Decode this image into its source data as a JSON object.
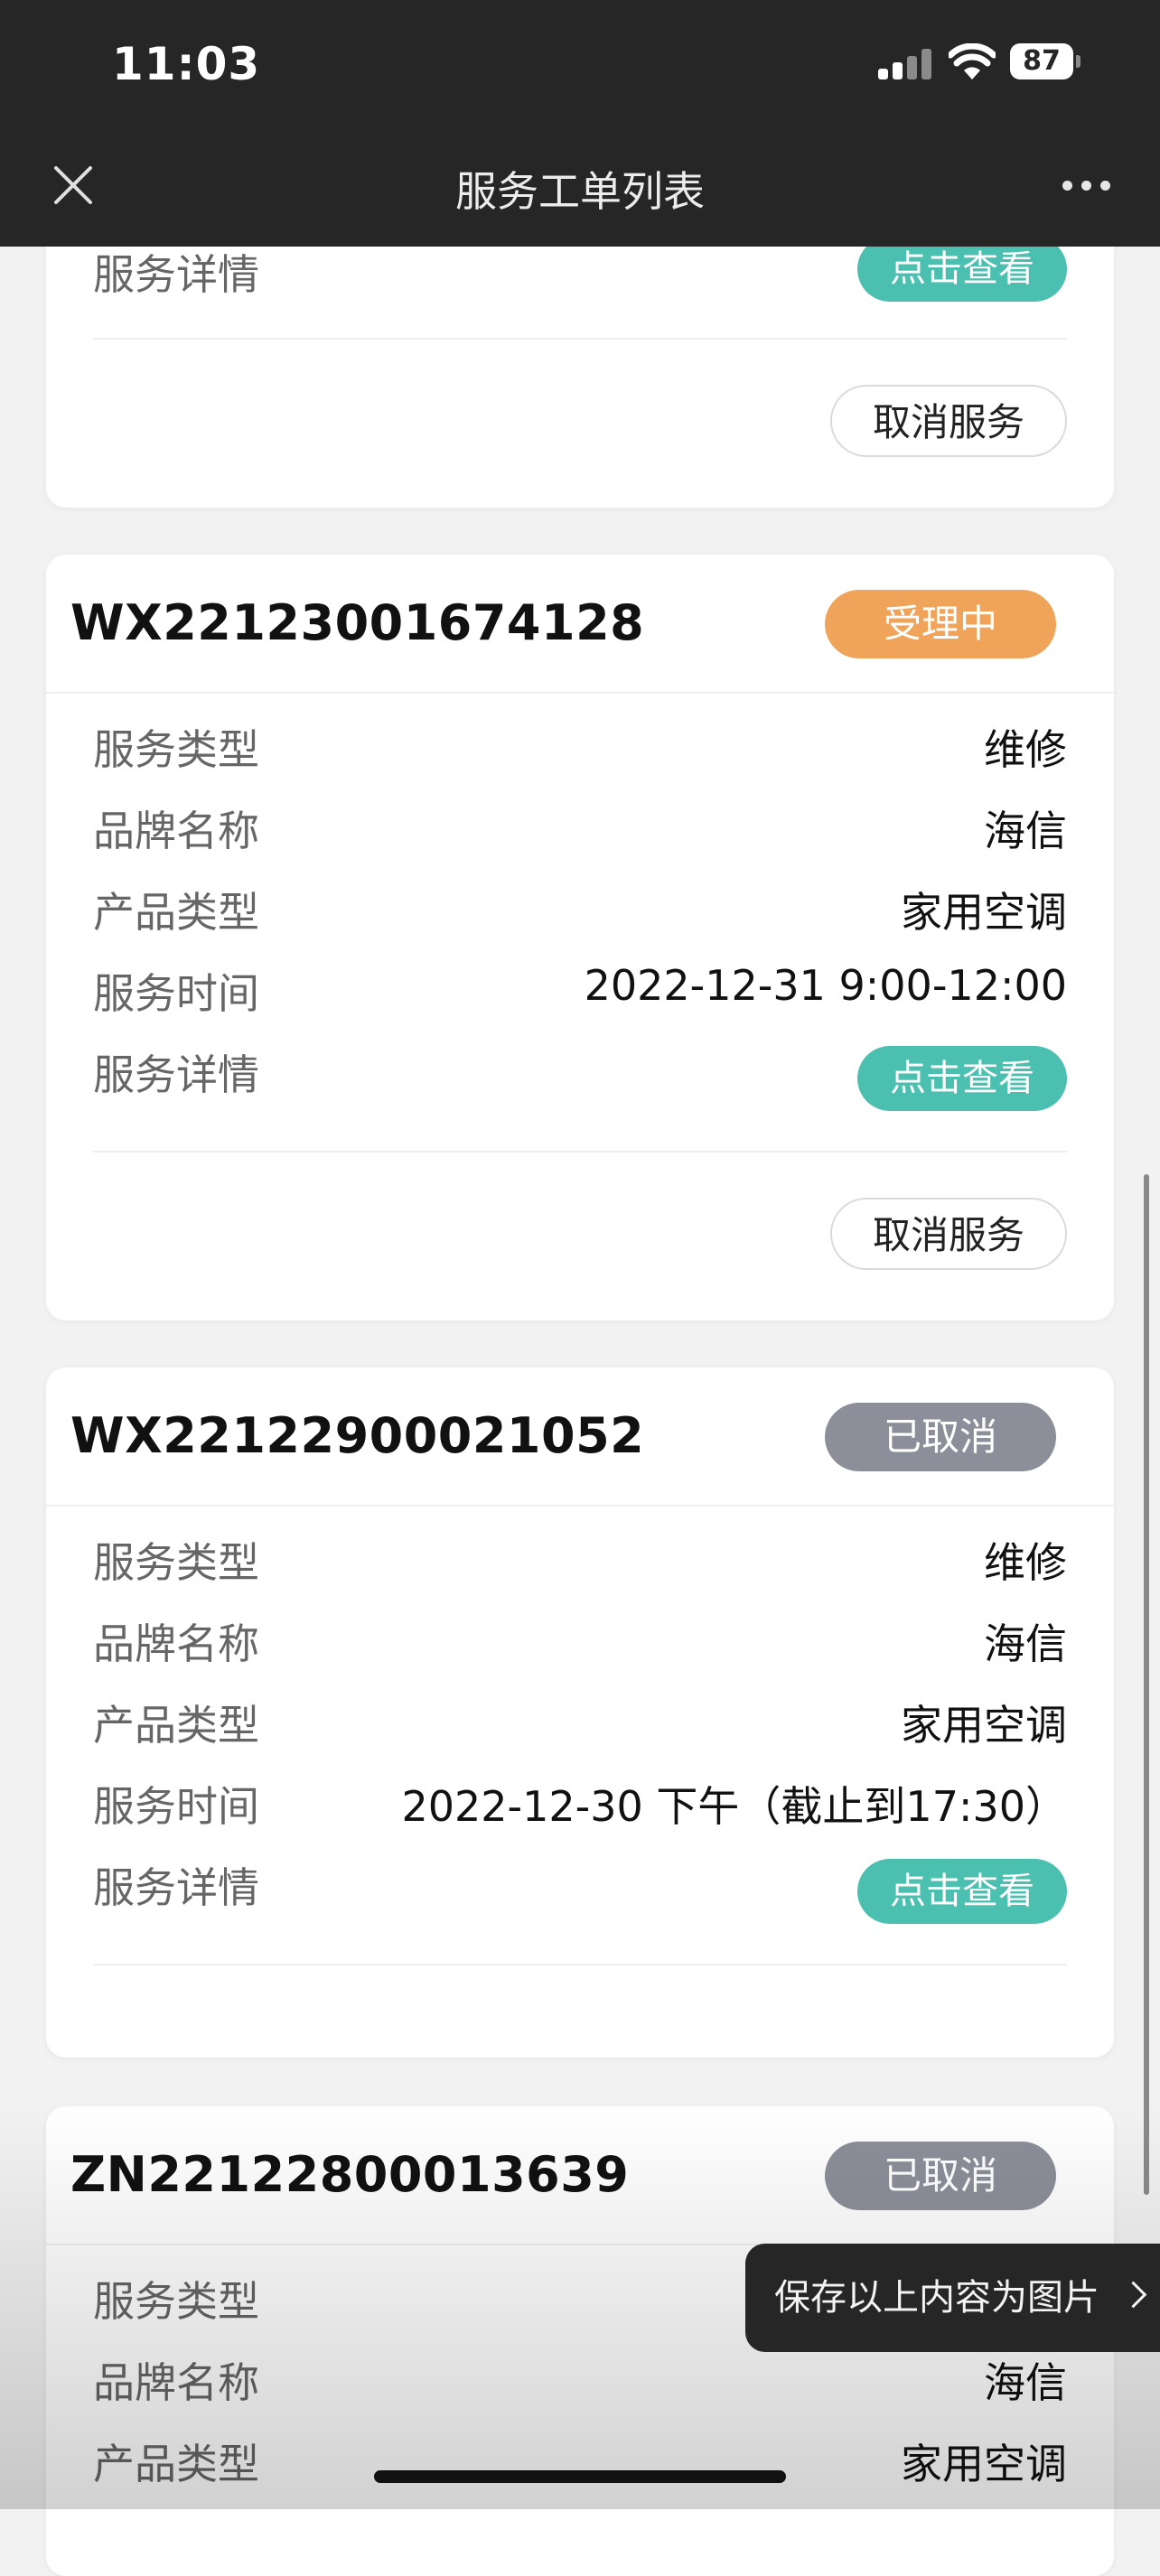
{
  "status_bar": {
    "time": "11:03",
    "battery": "87"
  },
  "nav": {
    "title": "服务工单列表"
  },
  "top_partial": {
    "detail_label": "服务详情",
    "detail_button": "点击查看",
    "cancel_button": "取消服务"
  },
  "orders": [
    {
      "order_no": "WX22123001674128",
      "status": "受理中",
      "rows": [
        {
          "label": "服务类型",
          "value": "维修"
        },
        {
          "label": "品牌名称",
          "value": "海信"
        },
        {
          "label": "产品类型",
          "value": "家用空调"
        },
        {
          "label": "服务时间",
          "value": "2022-12-31 9:00-12:00"
        }
      ],
      "detail_label": "服务详情",
      "detail_button": "点击查看",
      "cancel_button": "取消服务"
    },
    {
      "order_no": "WX22122900021052",
      "status": "已取消",
      "rows": [
        {
          "label": "服务类型",
          "value": "维修"
        },
        {
          "label": "品牌名称",
          "value": "海信"
        },
        {
          "label": "产品类型",
          "value": "家用空调"
        },
        {
          "label": "服务时间",
          "value": "2022-12-30 下午（截止到17:30）"
        }
      ],
      "detail_label": "服务详情",
      "detail_button": "点击查看"
    },
    {
      "order_no": "ZN22122800013639",
      "status": "已取消",
      "rows": [
        {
          "label": "服务类型",
          "value": ""
        },
        {
          "label": "品牌名称",
          "value": "海信"
        },
        {
          "label": "产品类型",
          "value": "家用空调"
        }
      ]
    }
  ],
  "toast": {
    "label": "保存以上内容为图片"
  },
  "colors": {
    "processing": "#f0a45a",
    "cancelled": "#8c8f99",
    "detail_button": "#4cc0b0",
    "nav_bg": "#262626"
  }
}
